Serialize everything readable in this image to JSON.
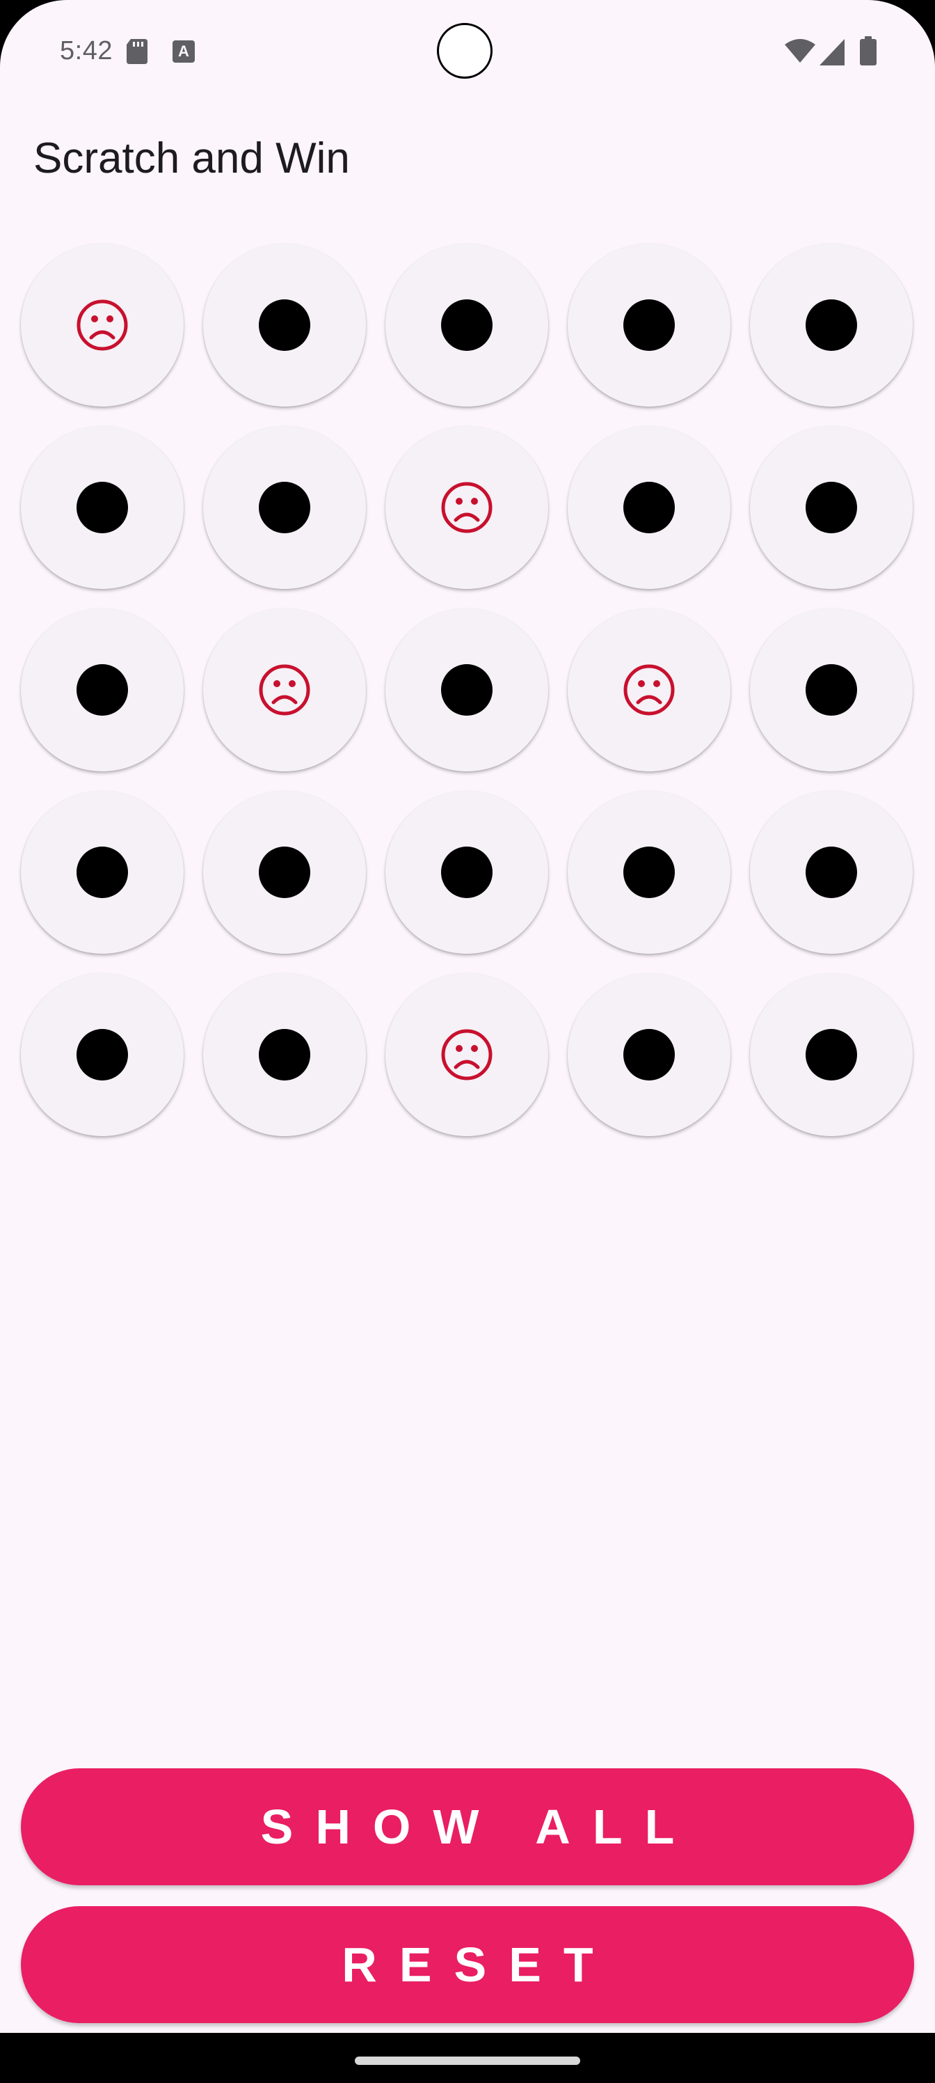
{
  "status_bar": {
    "time": "5:42",
    "icons": [
      "sd-card-icon",
      "a-keyboard-icon",
      "wifi-icon",
      "signal-icon",
      "battery-icon"
    ],
    "a_icon_letter": "A"
  },
  "app": {
    "title": "Scratch and Win"
  },
  "grid": {
    "rows": 5,
    "columns": 5,
    "cells": [
      "sad",
      "dot",
      "dot",
      "dot",
      "dot",
      "dot",
      "dot",
      "sad",
      "dot",
      "dot",
      "dot",
      "sad",
      "dot",
      "sad",
      "dot",
      "dot",
      "dot",
      "dot",
      "dot",
      "dot",
      "dot",
      "dot",
      "sad",
      "dot",
      "dot"
    ]
  },
  "buttons": {
    "show_all": "SHOW ALL",
    "reset": "RESET"
  },
  "colors": {
    "background": "#fcf5fc",
    "cell": "#f5f1f6",
    "accent": "#e91e63",
    "sad_face": "#c8102e",
    "dot": "#000000"
  }
}
